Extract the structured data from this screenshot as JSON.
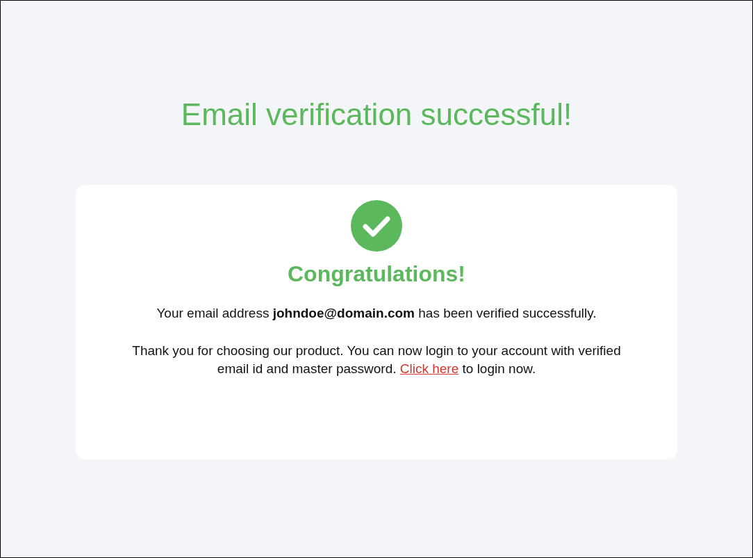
{
  "heading": "Email verification successful!",
  "card": {
    "icon": {
      "kind": "success"
    },
    "title": "Congratulations!",
    "message": "Your email address **johndoe@domain.com** has been verified successfully.",
    "note": {
      "text": "Thank you for choosing our product. You can now login to your account with verified email id and master password.",
      "link": "Click here",
      "after": "to login now."
    }
  }
}
